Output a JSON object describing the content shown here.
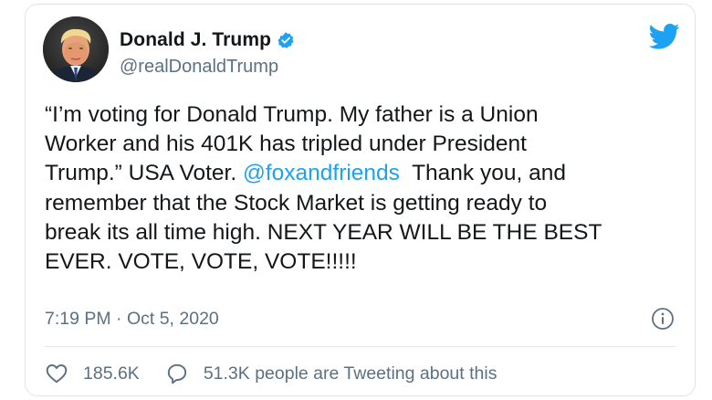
{
  "author": {
    "name": "Donald J. Trump",
    "handle": "@realDonaldTrump",
    "verified": true,
    "avatar_icon": "profile-photo"
  },
  "tweet": {
    "lines": [
      [
        "“I’m voting for Donald Trump. My father is a Union"
      ],
      [
        "Worker and his 401K has tripled under President"
      ],
      [
        "Trump.” USA Voter. ",
        "@foxandfriends",
        "  Thank you, and"
      ],
      [
        "remember that the Stock Market is getting ready to"
      ],
      [
        "break its all time high. NEXT YEAR WILL BE THE BEST"
      ],
      [
        "EVER. VOTE, VOTE, VOTE!!!!!"
      ]
    ],
    "mention": "@foxandfriends",
    "timestamp": "7:19 PM · Oct 5, 2020"
  },
  "stats": {
    "likes": "185.6K",
    "tweeting": "51.3K people are Tweeting about this"
  },
  "icons": {
    "brand": "twitter-bird-icon",
    "verified": "verified-badge-icon",
    "info": "info-icon",
    "like": "heart-icon",
    "reply": "speech-bubble-icon"
  },
  "colors": {
    "accent": "#1da1f2",
    "text": "#14171a",
    "secondary": "#5b7083",
    "border": "#dfe3e8"
  }
}
